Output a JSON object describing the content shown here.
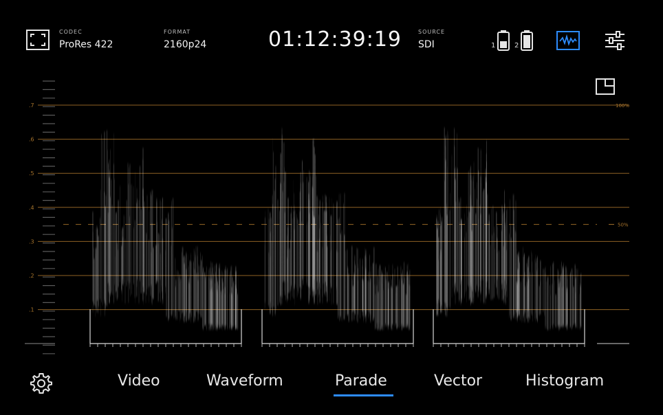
{
  "header": {
    "codec": {
      "label": "CODEC",
      "value": "ProRes 422"
    },
    "format": {
      "label": "FORMAT",
      "value": "2160p24"
    },
    "timecode": "01:12:39:19",
    "source": {
      "label": "SOURCE",
      "value": "SDI"
    },
    "battery_1_label": "1",
    "battery_2_label": "2",
    "icons": {
      "fullscreen": "fullscreen-frame-icon",
      "battery_1": "battery-icon",
      "battery_2": "battery-icon",
      "scopes": "waveform-scope-icon",
      "settings_sliders": "sliders-icon",
      "layout": "picture-in-picture-icon",
      "gear": "gear-icon"
    }
  },
  "scope": {
    "type": "parade",
    "graticule_labels": [
      ".7",
      ".6",
      ".5",
      ".4",
      ".3",
      ".2",
      ".1"
    ],
    "ref_100": "100%",
    "ref_50": "50%",
    "graticule_color": "#a8742c",
    "trace_color": "#ffffff"
  },
  "tabs": {
    "items": [
      {
        "label": "Video"
      },
      {
        "label": "Waveform"
      },
      {
        "label": "Parade",
        "active": true
      },
      {
        "label": "Vector"
      },
      {
        "label": "Histogram"
      }
    ],
    "active_color": "#2d8cff"
  }
}
